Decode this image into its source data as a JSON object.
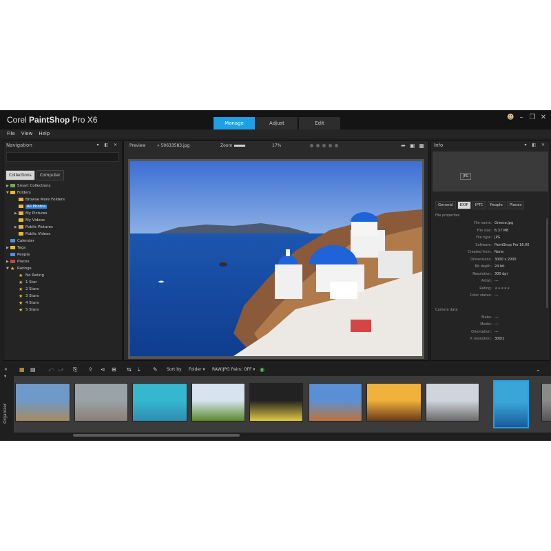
{
  "title": {
    "prefix": "Corel",
    "name": "PaintShop",
    "suffix": "Pro X6"
  },
  "tabs": [
    {
      "label": "Manage",
      "active": true
    },
    {
      "label": "Adjust"
    },
    {
      "label": "Edit"
    }
  ],
  "menu": [
    "File",
    "View",
    "Help"
  ],
  "navigation": {
    "title": "Navigation",
    "tabs": [
      "Collections",
      "Computer"
    ],
    "tree": [
      {
        "label": "Smart Collections",
        "indent": 1,
        "icon": "collection-icon",
        "twisty": "▶"
      },
      {
        "label": "Folders",
        "indent": 1,
        "icon": "folder-icon",
        "twisty": "▼"
      },
      {
        "label": "Browse More Folders",
        "indent": 2,
        "icon": "folder-icon"
      },
      {
        "label": "All Photos",
        "indent": 2,
        "icon": "folder-icon",
        "selected": true
      },
      {
        "label": "My Pictures",
        "indent": 2,
        "icon": "folder-icon",
        "twisty": "▶"
      },
      {
        "label": "My Videos",
        "indent": 2,
        "icon": "folder-icon"
      },
      {
        "label": "Public Pictures",
        "indent": 2,
        "icon": "folder-icon",
        "twisty": "▶"
      },
      {
        "label": "Public Videos",
        "indent": 2,
        "icon": "folder-icon"
      },
      {
        "label": "Calendar",
        "indent": 1,
        "icon": "calendar-icon"
      },
      {
        "label": "Tags",
        "indent": 1,
        "icon": "tag-icon",
        "twisty": "▶"
      },
      {
        "label": "People",
        "indent": 1,
        "icon": "people-icon"
      },
      {
        "label": "Places",
        "indent": 1,
        "icon": "places-icon",
        "twisty": "▶"
      },
      {
        "label": "Ratings",
        "indent": 1,
        "icon": "star-icon",
        "twisty": "▼"
      },
      {
        "label": "No Rating",
        "indent": 2,
        "icon": "star-icon"
      },
      {
        "label": "1 Star",
        "indent": 2,
        "icon": "star-icon"
      },
      {
        "label": "2 Stars",
        "indent": 2,
        "icon": "star-icon"
      },
      {
        "label": "3 Stars",
        "indent": 2,
        "icon": "star-icon"
      },
      {
        "label": "4 Stars",
        "indent": 2,
        "icon": "star-icon"
      },
      {
        "label": "5 Stars",
        "indent": 2,
        "icon": "star-icon"
      }
    ]
  },
  "preview": {
    "label": "Preview",
    "filename": "50633583.jpg",
    "zoom_label": "Zoom",
    "zoom_percent": "17%"
  },
  "info": {
    "title": "Info",
    "histogram_badge": "JPG",
    "tabs": [
      "General",
      "EXIF",
      "IPTC",
      "People",
      "Places"
    ],
    "active_tab": "EXIF",
    "file_section": "File properties",
    "file_props": [
      {
        "k": "File name:",
        "v": "Greece.jpg"
      },
      {
        "k": "File size:",
        "v": "6.37 MB"
      },
      {
        "k": "File type:",
        "v": "JPG"
      },
      {
        "k": "Software:",
        "v": "PaintShop Pro 16.00"
      },
      {
        "k": "Created from:",
        "v": "None"
      },
      {
        "k": "Dimensions:",
        "v": "3000 x 2000"
      },
      {
        "k": "Bit depth:",
        "v": "24 bit"
      },
      {
        "k": "Resolution:",
        "v": "300 dpi"
      },
      {
        "k": "Artist:",
        "v": "---"
      },
      {
        "k": "Rating:",
        "v": "★★★★★"
      },
      {
        "k": "Color status:",
        "v": "---"
      }
    ],
    "camera_section": "Camera data",
    "camera_props": [
      {
        "k": "Make:",
        "v": "---"
      },
      {
        "k": "Model:",
        "v": "---"
      },
      {
        "k": "Orientation:",
        "v": "---"
      },
      {
        "k": "X resolution:",
        "v": "300/1"
      }
    ]
  },
  "organizer": {
    "label": "Organizer",
    "sort_label": "Sort by",
    "sort_value": "Folder",
    "raw_label": "RAW/JPG Pairs: OFF",
    "thumb_count": 10
  },
  "colors": {
    "accent": "#1ea0e6",
    "panel": "#242424",
    "chrome": "#141414",
    "sky": "#4f82d8",
    "sea": "#1a4fa5"
  }
}
